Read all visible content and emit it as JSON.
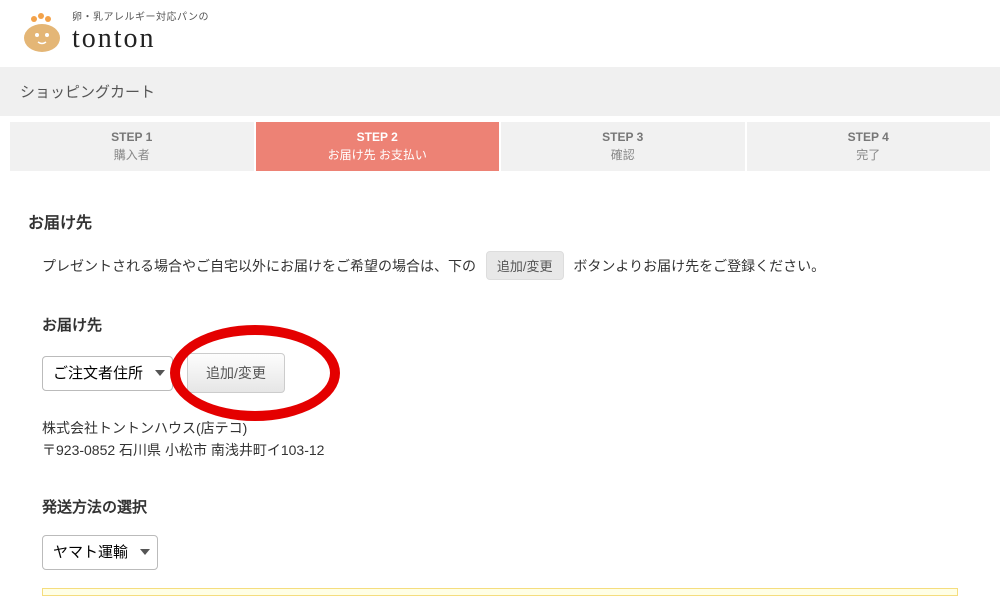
{
  "brand": {
    "tagline": "卵・乳アレルギー対応パンの",
    "name": "tonton"
  },
  "page_title": "ショッピングカート",
  "steps": [
    {
      "title": "STEP 1",
      "sub": "購入者"
    },
    {
      "title": "STEP 2",
      "sub": "お届け先 お支払い"
    },
    {
      "title": "STEP 3",
      "sub": "確認"
    },
    {
      "title": "STEP 4",
      "sub": "完了"
    }
  ],
  "delivery": {
    "heading": "お届け先",
    "instruction_prefix": "プレゼントされる場合やご自宅以外にお届けをご希望の場合は、下の",
    "instruction_badge": "追加/変更",
    "instruction_suffix": "ボタンよりお届け先をご登録ください。",
    "subheading": "お届け先",
    "select_value": "ご注文者住所",
    "add_change_label": "追加/変更",
    "address_name": "株式会社トントンハウス(店テコ)",
    "address_line": "〒923-0852 石川県 小松市 南浅井町イ103-12"
  },
  "shipping": {
    "heading": "発送方法の選択",
    "select_value": "ヤマト運輸"
  }
}
